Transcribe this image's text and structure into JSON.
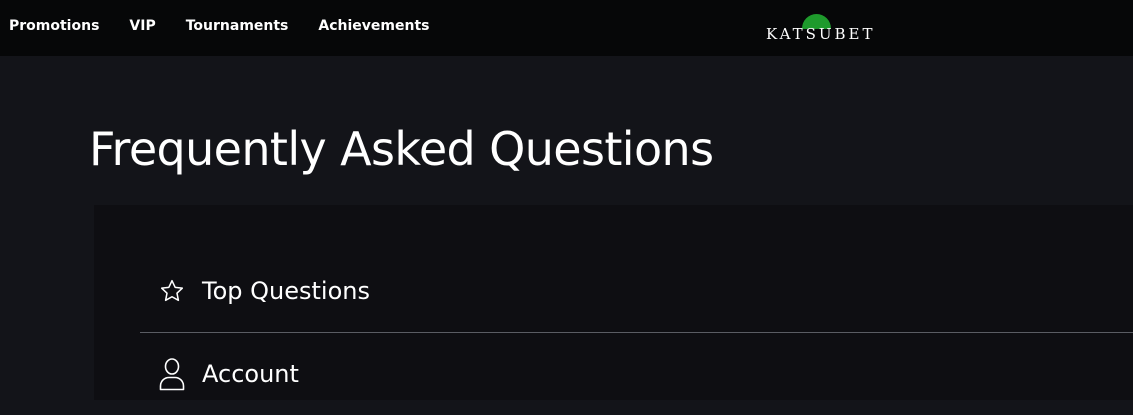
{
  "nav": {
    "items": [
      {
        "label": "Promotions"
      },
      {
        "label": "VIP"
      },
      {
        "label": "Tournaments"
      },
      {
        "label": "Achievements"
      }
    ]
  },
  "logo": {
    "text": "KATSUBET",
    "sun_color": "#1e9a2c"
  },
  "page": {
    "title": "Frequently Asked Questions"
  },
  "faq": {
    "categories": [
      {
        "label": "Top Questions",
        "icon": "star-outline-icon"
      },
      {
        "label": "Account",
        "icon": "user-outline-icon"
      }
    ]
  },
  "colors": {
    "topbar_bg": "#060708",
    "page_bg": "#131419",
    "panel_bg": "#0e0e12",
    "divider": "#5a5c63"
  }
}
